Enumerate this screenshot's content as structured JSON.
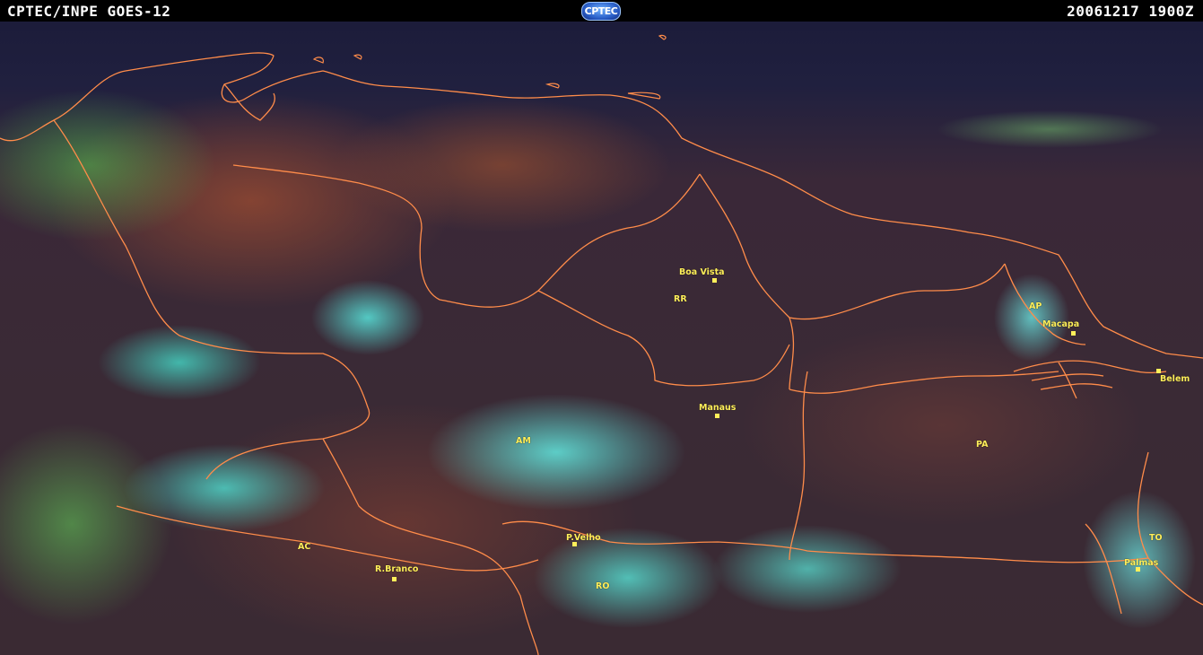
{
  "header": {
    "title_left": "CPTEC/INPE GOES-12",
    "logo_text": "CPTEC",
    "timestamp": "20061217  1900Z"
  },
  "colors": {
    "boundary": "#ff8c4a",
    "label": "#ffef5a",
    "cloud": "#5ef2e0"
  },
  "cities": [
    {
      "name": "Boa Vista"
    },
    {
      "name": "Macapa"
    },
    {
      "name": "Belem"
    },
    {
      "name": "Manaus"
    },
    {
      "name": "P.Velho"
    },
    {
      "name": "R.Branco"
    },
    {
      "name": "Palmas"
    }
  ],
  "states": [
    "RR",
    "AP",
    "AM",
    "PA",
    "AC",
    "RO",
    "TO"
  ]
}
